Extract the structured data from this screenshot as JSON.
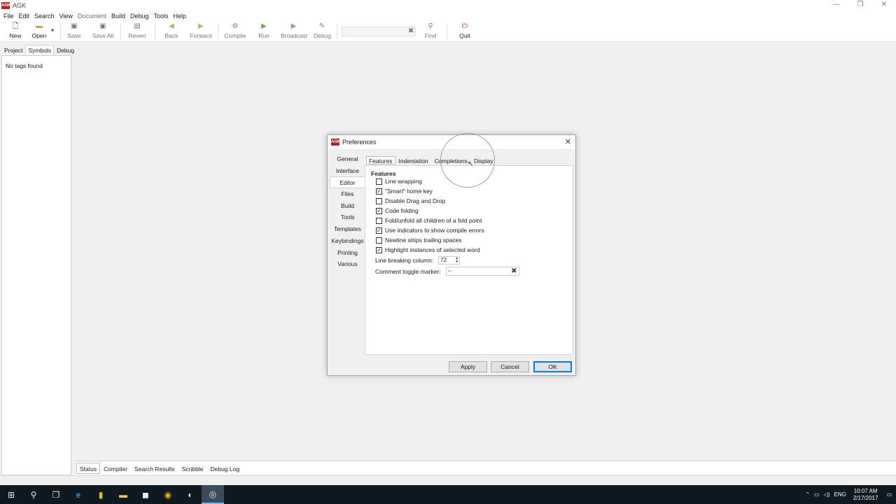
{
  "window": {
    "title": "AGK",
    "logo_text": "AGK"
  },
  "menu": [
    {
      "label": "File",
      "enabled": true
    },
    {
      "label": "Edit",
      "enabled": true
    },
    {
      "label": "Search",
      "enabled": true
    },
    {
      "label": "View",
      "enabled": true
    },
    {
      "label": "Document",
      "enabled": false
    },
    {
      "label": "Build",
      "enabled": true
    },
    {
      "label": "Debug",
      "enabled": true
    },
    {
      "label": "Tools",
      "enabled": true
    },
    {
      "label": "Help",
      "enabled": true
    }
  ],
  "toolbar": {
    "new": "New",
    "open": "Open",
    "save": "Save",
    "save_all": "Save All",
    "revert": "Revert",
    "back": "Back",
    "forward": "Forward",
    "compile": "Compile",
    "run": "Run",
    "broadcast": "Broadcast",
    "debug": "Debug",
    "find": "Find",
    "quit": "Quit",
    "search_value": ""
  },
  "side_tabs": {
    "project": "Project",
    "symbols": "Symbols",
    "debug": "Debug",
    "active": "Symbols"
  },
  "side_panel": {
    "message": "No tags found"
  },
  "bottom_tabs": {
    "status": "Status",
    "compiler": "Compiler",
    "search_results": "Search Results",
    "scribble": "Scribble",
    "debug_log": "Debug Log",
    "active": "Status"
  },
  "dialog": {
    "title": "Preferences",
    "categories": [
      "General",
      "Interface",
      "Editor",
      "Files",
      "Build",
      "Tools",
      "Templates",
      "Keybindings",
      "Printing",
      "Various"
    ],
    "active_category": "Editor",
    "tabs": [
      "Features",
      "Indentation",
      "Completions",
      "Display"
    ],
    "active_tab": "Features",
    "section_heading": "Features",
    "options": [
      {
        "label": "Line wrapping",
        "checked": false
      },
      {
        "label": "\"Smart\" home key",
        "checked": true
      },
      {
        "label": "Disable Drag and Drop",
        "checked": false
      },
      {
        "label": "Code folding",
        "checked": true
      },
      {
        "label": "Fold/unfold all children of a fold point",
        "checked": false
      },
      {
        "label": "Use indicators to show compile errors",
        "checked": true
      },
      {
        "label": "Newline strips trailing spaces",
        "checked": false
      },
      {
        "label": "Highlight instances of selected word",
        "checked": true
      }
    ],
    "line_breaking_label": "Line breaking column:",
    "line_breaking_value": "72",
    "comment_toggle_label": "Comment toggle marker:",
    "comment_toggle_value": "~",
    "buttons": {
      "apply": "Apply",
      "cancel": "Cancel",
      "ok": "OK"
    }
  },
  "tray": {
    "language": "ENG",
    "time": "10:07 AM",
    "date": "2/17/2017"
  }
}
